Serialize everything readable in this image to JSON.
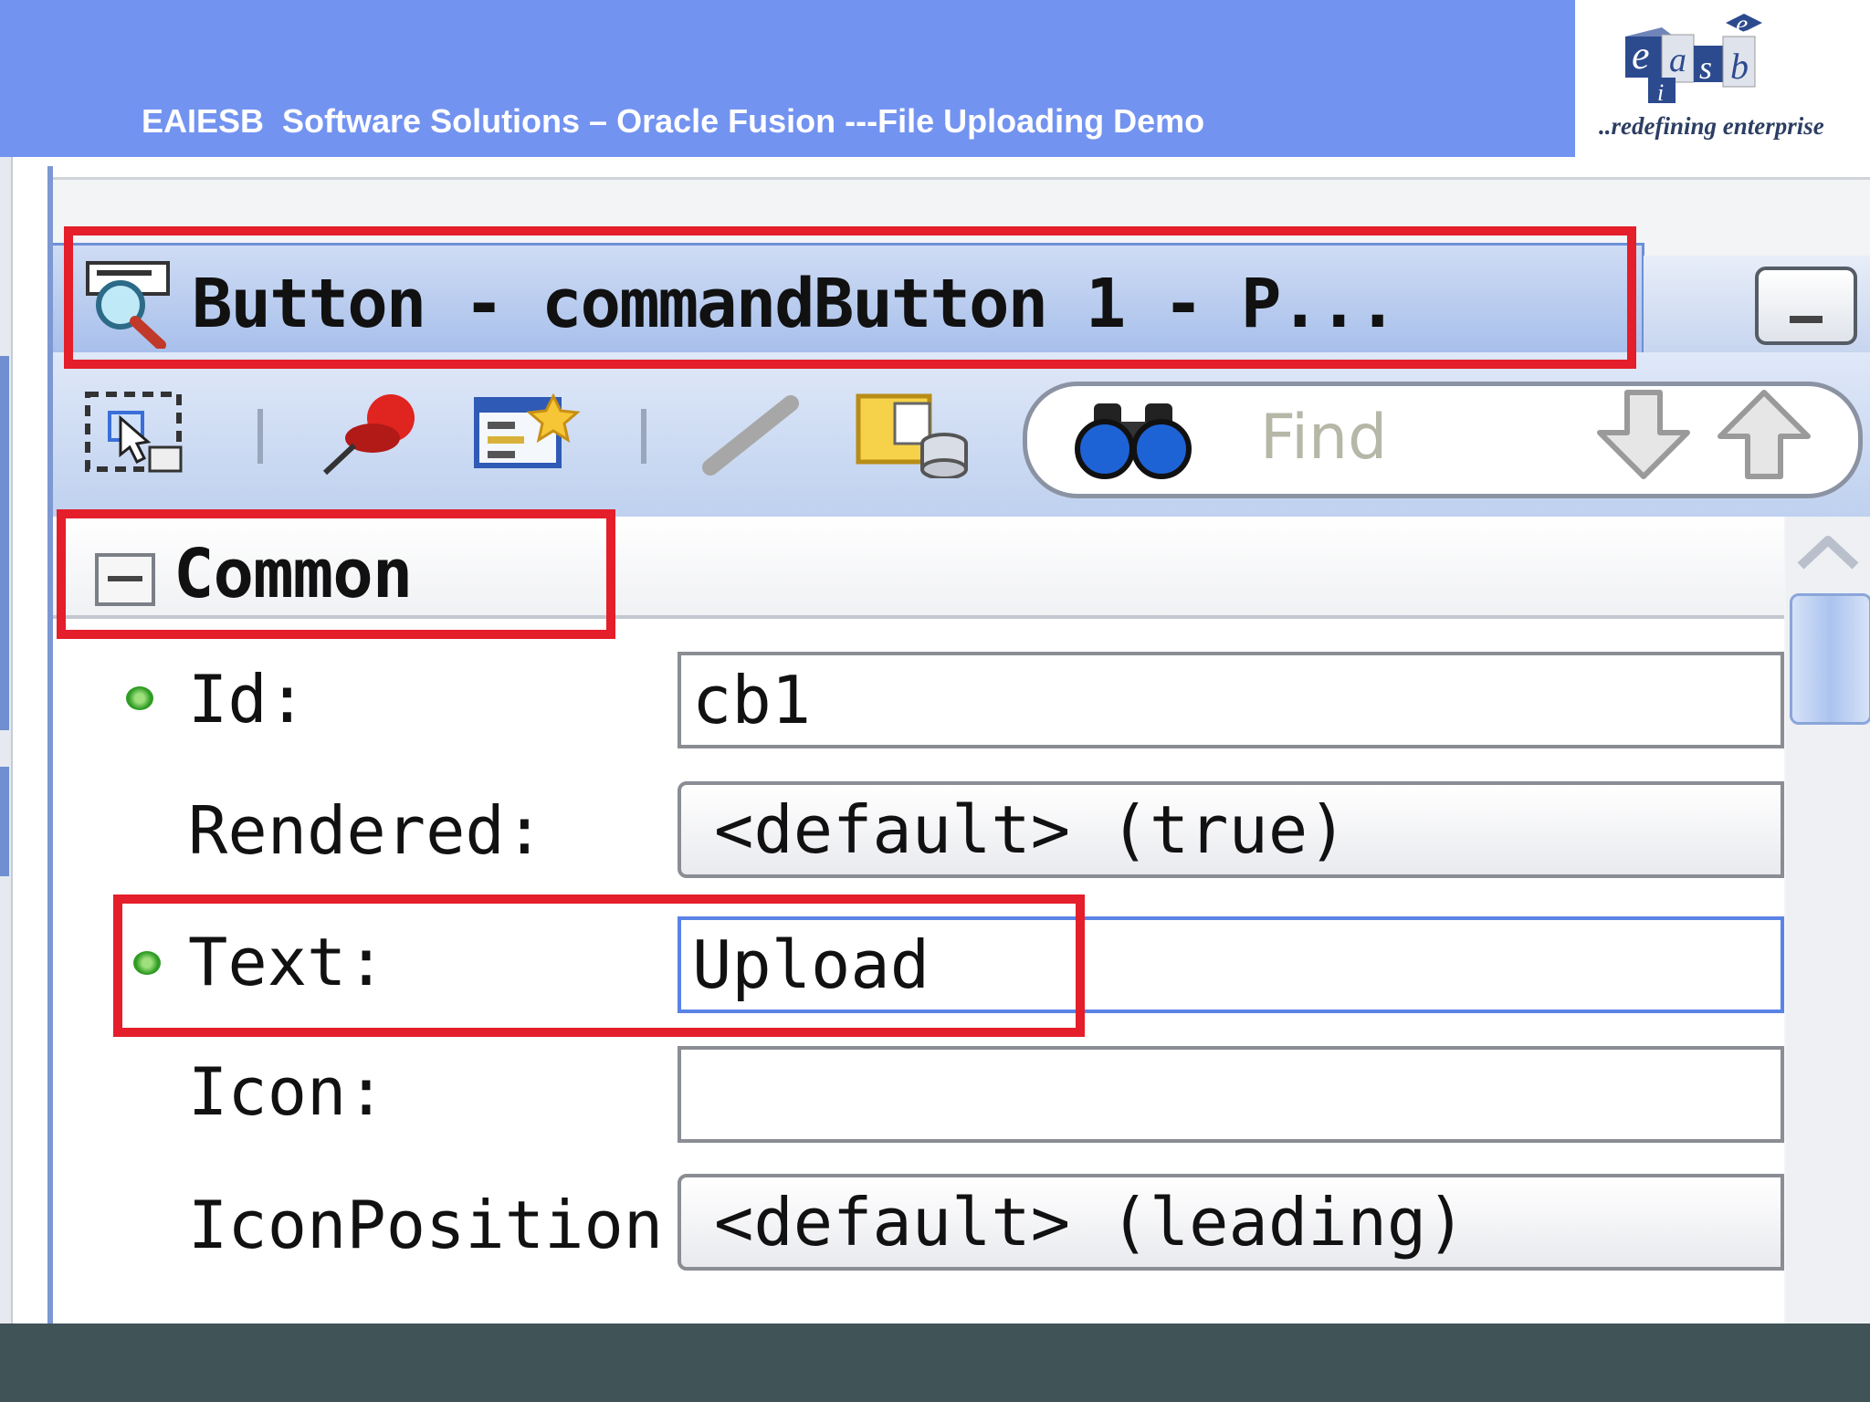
{
  "slide": {
    "title": "EAIESB  Software Solutions – Oracle Fusion ---File Uploading Demo",
    "logo_letters": [
      "e",
      "a",
      "e",
      "s",
      "b",
      "i"
    ],
    "logo_tagline": "..redefining enterprise"
  },
  "window": {
    "title": "Button - commandButton 1 - P...",
    "minimize_icon": "minimize-icon"
  },
  "toolbar": {
    "icons": [
      "select-icon",
      "pin-icon",
      "edit-properties-icon",
      "line-icon",
      "datasource-icon"
    ],
    "find_placeholder": "Find",
    "search_icon": "binoculars-icon",
    "nav_icons": [
      "arrow-down-icon",
      "arrow-up-icon"
    ]
  },
  "section": {
    "title": "Common",
    "properties": [
      {
        "label": "Id:",
        "value": "cb1",
        "kind": "text",
        "modified": true
      },
      {
        "label": "Rendered:",
        "value": "<default> (true)",
        "kind": "combo",
        "modified": false
      },
      {
        "label": "Text:",
        "value": "Upload",
        "kind": "text",
        "modified": true
      },
      {
        "label": "Icon:",
        "value": "",
        "kind": "text",
        "modified": false
      },
      {
        "label": "IconPosition:",
        "value": "<default> (leading)",
        "kind": "combo",
        "modified": false
      }
    ]
  },
  "colors": {
    "header_blue": "#7393f0",
    "highlight_red": "#e41e2a",
    "footer": "#405357"
  }
}
